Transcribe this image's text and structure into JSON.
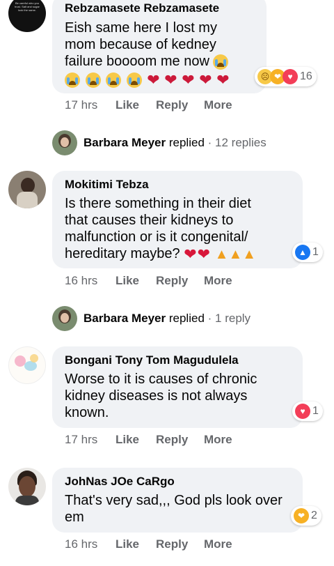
{
  "comments": [
    {
      "author": "Rebzamasete Rebzamasete",
      "lines": [
        "Eish same here I lost my",
        "mom because of kedney",
        "failure boooom me now"
      ],
      "time": "17 hrs",
      "like": "Like",
      "reply": "Reply",
      "more": "More",
      "reaction_count": "16"
    },
    {
      "author": "Mokitimi Tebza",
      "lines": [
        "Is there something in their diet",
        "that causes their kidneys to",
        "malfunction or is it congenital/",
        "hereditary maybe?"
      ],
      "time": "16 hrs",
      "like": "Like",
      "reply": "Reply",
      "more": "More",
      "reaction_count": "1"
    },
    {
      "author": "Bongani Tony Tom Magudulela",
      "lines": [
        "Worse to it is causes of chronic",
        "kidney diseases is not always",
        "known."
      ],
      "time": "17 hrs",
      "like": "Like",
      "reply": "Reply",
      "more": "More",
      "reaction_count": "1"
    },
    {
      "author": "JohNas JOe CaRgo",
      "lines": [
        "That's very sad,,, God pls look over",
        "em"
      ],
      "time": "16 hrs",
      "like": "Like",
      "reply": "Reply",
      "more": "More",
      "reaction_count": "2"
    }
  ],
  "replies": [
    {
      "name": "Barbara Meyer",
      "verb": "replied",
      "count": "· 12 replies"
    },
    {
      "name": "Barbara Meyer",
      "verb": "replied",
      "count": "· 1 reply"
    }
  ],
  "avatar_text": {
    "first": "Be careful who you trust. Salt and sugar look the same."
  },
  "colors": {
    "bubble": "#f0f2f5",
    "secondary_text": "#65676b",
    "like_blue": "#1877f2",
    "love_red": "#f33e58"
  }
}
